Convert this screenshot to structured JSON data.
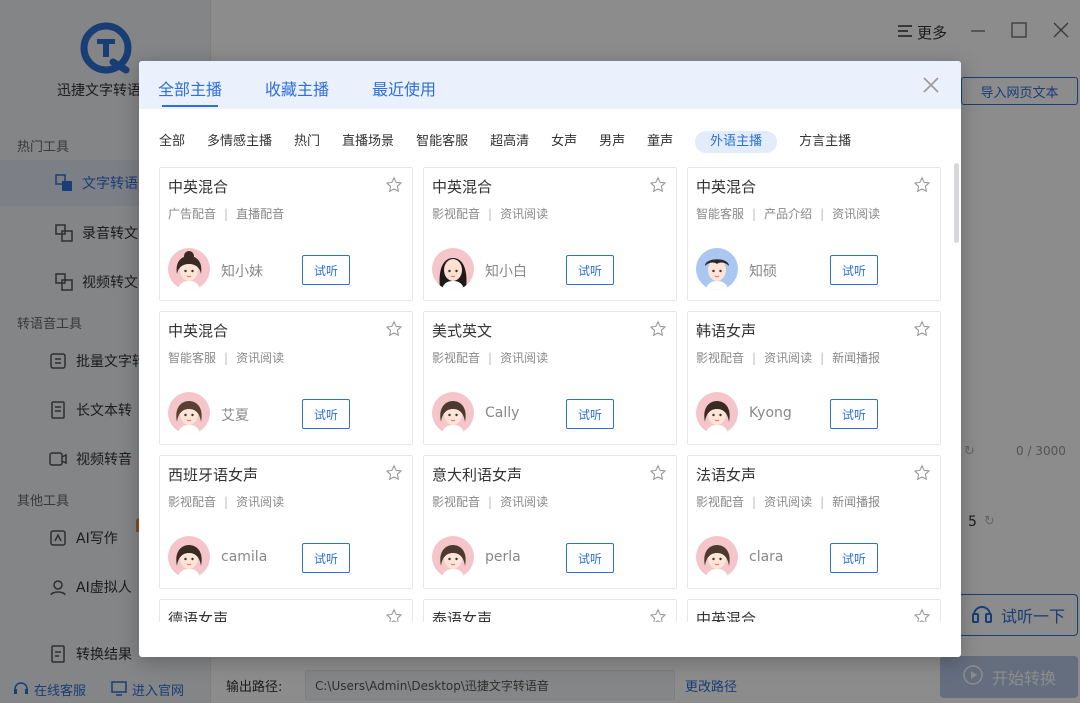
{
  "app": {
    "title": "迅捷文字转语",
    "sections": {
      "hot": "热门工具",
      "tts": "转语音工具",
      "other": "其他工具"
    },
    "nav": {
      "text_to_speech": "文字转语",
      "recording": "录音转文",
      "video": "视频转文",
      "batch": "批量文字转",
      "long_text": "长文本转",
      "video_voice": "视频转音",
      "ai_write": "AI写作",
      "ai_virtual": "AI虚拟人",
      "results": "转换结果"
    },
    "bottom": {
      "service": "在线客服",
      "website": "进入官网"
    }
  },
  "main": {
    "more": "更多",
    "import_btn": "导入网页文本",
    "counter": "0 / 3000",
    "speed": "5",
    "listen_btn": "试听一下",
    "start_btn": "开始转换",
    "output_label": "输出路径:",
    "output_path": "C:\\Users\\Admin\\Desktop\\迅捷文字转语音",
    "change_path": "更改路径"
  },
  "modal": {
    "tabs": [
      "全部主播",
      "收藏主播",
      "最近使用"
    ],
    "categories": [
      "全部",
      "多情感主播",
      "热门",
      "直播场景",
      "智能客服",
      "超高清",
      "女声",
      "男声",
      "童声",
      "外语主播",
      "方言主播"
    ],
    "active_category": "外语主播",
    "try_label": "试听",
    "voices": [
      {
        "title": "中英混合",
        "tags": [
          "广告配音",
          "直播配音"
        ],
        "speaker": "知小妹"
      },
      {
        "title": "中英混合",
        "tags": [
          "影视配音",
          "资讯阅读"
        ],
        "speaker": "知小白"
      },
      {
        "title": "中英混合",
        "tags": [
          "智能客服",
          "产品介绍",
          "资讯阅读"
        ],
        "speaker": "知硕"
      },
      {
        "title": "中英混合",
        "tags": [
          "智能客服",
          "资讯阅读"
        ],
        "speaker": "艾夏"
      },
      {
        "title": "美式英文",
        "tags": [
          "影视配音",
          "资讯阅读"
        ],
        "speaker": "Cally"
      },
      {
        "title": "韩语女声",
        "tags": [
          "影视配音",
          "资讯阅读",
          "新闻播报"
        ],
        "speaker": "Kyong"
      },
      {
        "title": "西班牙语女声",
        "tags": [
          "影视配音",
          "资讯阅读"
        ],
        "speaker": "camila"
      },
      {
        "title": "意大利语女声",
        "tags": [
          "影视配音",
          "资讯阅读"
        ],
        "speaker": "perla"
      },
      {
        "title": "法语女声",
        "tags": [
          "影视配音",
          "资讯阅读",
          "新闻播报"
        ],
        "speaker": "clara"
      },
      {
        "title": "德语女声",
        "tags": [],
        "speaker": ""
      },
      {
        "title": "泰语女声",
        "tags": [],
        "speaker": ""
      },
      {
        "title": "中英混合",
        "tags": [],
        "speaker": ""
      }
    ]
  },
  "colors": {
    "accent": "#2f6fd6",
    "modal_header": "#eaf1fd",
    "avatar_bg_pink": "#f4c6c9",
    "avatar_bg_blue": "#a9c7f0"
  }
}
